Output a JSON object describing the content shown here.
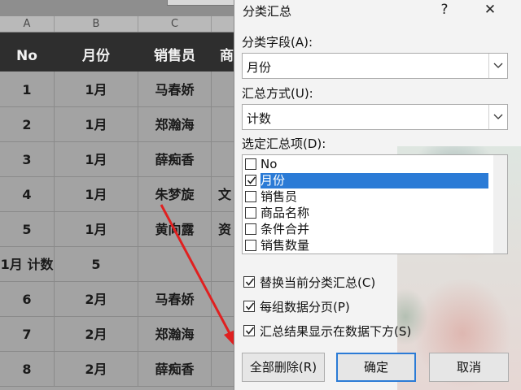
{
  "sheet": {
    "columns": [
      "A",
      "B",
      "C"
    ],
    "headers": [
      "No",
      "月份",
      "销售员",
      "商"
    ],
    "rows": [
      [
        "1",
        "1月",
        "马春娇",
        ""
      ],
      [
        "2",
        "1月",
        "郑瀚海",
        ""
      ],
      [
        "3",
        "1月",
        "薛痴香",
        ""
      ],
      [
        "4",
        "1月",
        "朱梦旋",
        "文"
      ],
      [
        "5",
        "1月",
        "黄向露",
        "资"
      ],
      [
        "1月 计数",
        "5",
        "",
        ""
      ],
      [
        "6",
        "2月",
        "马春娇",
        ""
      ],
      [
        "7",
        "2月",
        "郑瀚海",
        ""
      ],
      [
        "8",
        "2月",
        "薛痴香",
        ""
      ]
    ]
  },
  "dialog": {
    "title": "分类汇总",
    "help_label": "?",
    "close_label": "✕",
    "group_field_label": "分类字段(A):",
    "group_field_value": "月份",
    "function_label": "汇总方式(U):",
    "function_value": "计数",
    "items_label": "选定汇总项(D):",
    "items": [
      {
        "label": "No",
        "checked": false,
        "selected": false
      },
      {
        "label": "月份",
        "checked": true,
        "selected": true
      },
      {
        "label": "销售员",
        "checked": false,
        "selected": false
      },
      {
        "label": "商品名称",
        "checked": false,
        "selected": false
      },
      {
        "label": "条件合并",
        "checked": false,
        "selected": false
      },
      {
        "label": "销售数量",
        "checked": false,
        "selected": false
      }
    ],
    "options": [
      {
        "label": "替换当前分类汇总(C)",
        "checked": true
      },
      {
        "label": "每组数据分页(P)",
        "checked": true
      },
      {
        "label": "汇总结果显示在数据下方(S)",
        "checked": true
      }
    ],
    "buttons": {
      "remove_all": "全部删除(R)",
      "ok": "确定",
      "cancel": "取消"
    }
  },
  "colors": {
    "accent": "#2b7bd6",
    "arrow": "#e02020",
    "header_bar": "#2e2e2e"
  }
}
